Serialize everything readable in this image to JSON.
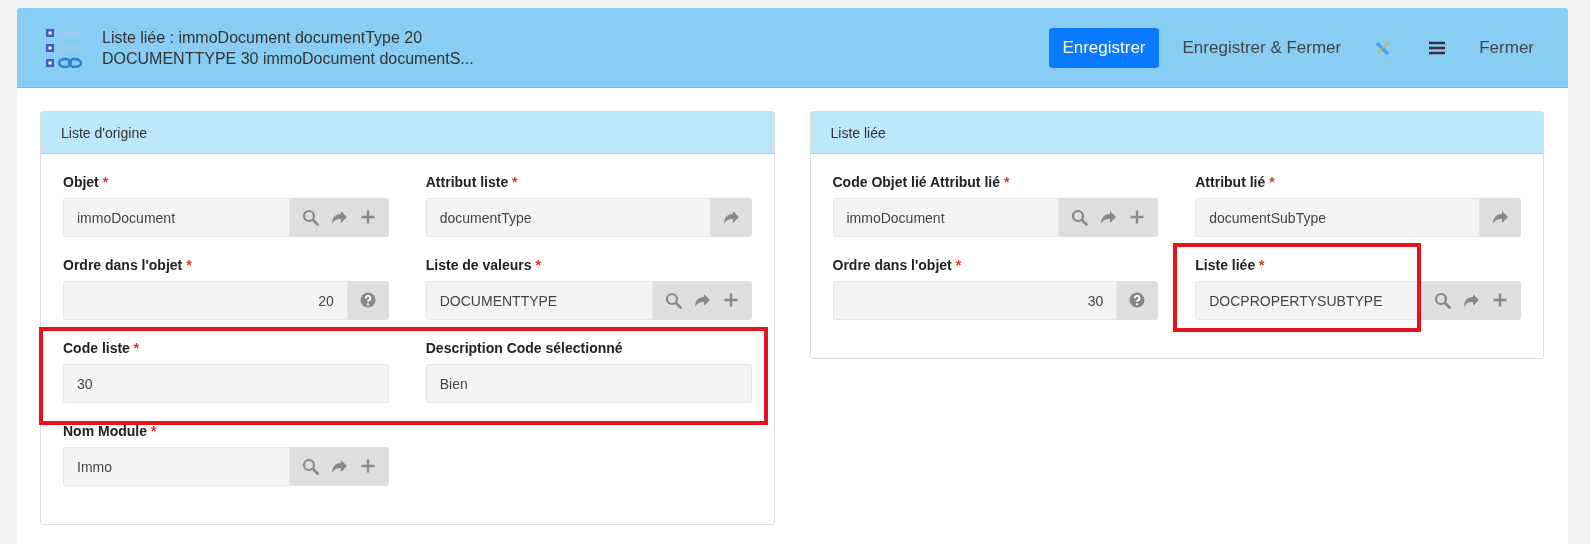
{
  "header": {
    "title_lines": [
      "Liste liée : immoDocument documentType 20",
      "DOCUMENTTYPE 30 immoDocument documentS..."
    ],
    "actions": [
      {
        "kind": "primary",
        "label": "Enregistrer"
      },
      {
        "kind": "text",
        "label": "Enregistrer & Fermer"
      },
      {
        "kind": "tools"
      },
      {
        "kind": "menu"
      },
      {
        "kind": "text",
        "label": "Fermer"
      }
    ]
  },
  "panels": [
    {
      "title": "Liste d'origine",
      "rows": [
        {
          "highlighted": false,
          "fields": [
            {
              "label": "Objet",
              "required_mark": "*",
              "kind": "text",
              "value": "immoDocument",
              "highlighted": false,
              "buttons": [
                {
                  "kind": "search"
                },
                {
                  "kind": "forward"
                },
                {
                  "kind": "add"
                }
              ]
            },
            {
              "label": "Attribut liste",
              "required_mark": "*",
              "kind": "text",
              "value": "documentType",
              "highlighted": false,
              "buttons": [
                {
                  "kind": "forward"
                }
              ]
            }
          ]
        },
        {
          "highlighted": false,
          "fields": [
            {
              "label": "Ordre dans l'objet",
              "required_mark": "*",
              "kind": "number",
              "value": "20",
              "highlighted": false,
              "buttons": [
                {
                  "kind": "help"
                }
              ]
            },
            {
              "label": "Liste de valeurs",
              "required_mark": "*",
              "kind": "text",
              "value": "DOCUMENTTYPE",
              "highlighted": false,
              "buttons": [
                {
                  "kind": "search"
                },
                {
                  "kind": "forward"
                },
                {
                  "kind": "add"
                }
              ]
            }
          ]
        },
        {
          "highlighted": true,
          "fields": [
            {
              "label": "Code liste",
              "required_mark": "*",
              "kind": "text",
              "value": "30",
              "highlighted": false
            },
            {
              "label": "Description Code sélectionné",
              "kind": "text",
              "value": "Bien",
              "highlighted": false
            }
          ]
        },
        {
          "highlighted": false,
          "fields": [
            {
              "label": "Nom Module",
              "required_mark": "*",
              "kind": "text",
              "value": "Immo",
              "highlighted": false,
              "buttons": [
                {
                  "kind": "search"
                },
                {
                  "kind": "forward"
                },
                {
                  "kind": "add"
                }
              ]
            }
          ]
        }
      ]
    },
    {
      "title": "Liste liée",
      "rows": [
        {
          "highlighted": false,
          "fields": [
            {
              "label": "Code Objet lié Attribut lié",
              "required_mark": "*",
              "kind": "text",
              "value": "immoDocument",
              "highlighted": false,
              "buttons": [
                {
                  "kind": "search"
                },
                {
                  "kind": "forward"
                },
                {
                  "kind": "add"
                }
              ]
            },
            {
              "label": "Attribut lié",
              "required_mark": "*",
              "kind": "text",
              "value": "documentSubType",
              "highlighted": false,
              "buttons": [
                {
                  "kind": "forward"
                }
              ]
            }
          ]
        },
        {
          "highlighted": false,
          "fields": [
            {
              "label": "Ordre dans l'objet",
              "required_mark": "*",
              "kind": "number",
              "value": "30",
              "highlighted": false,
              "buttons": [
                {
                  "kind": "help"
                }
              ]
            },
            {
              "label": "Liste liée",
              "required_mark": "*",
              "kind": "text",
              "value": "DOCPROPERTYSUBTYPE",
              "highlighted": true,
              "buttons": [
                {
                  "kind": "search"
                },
                {
                  "kind": "forward"
                },
                {
                  "kind": "add"
                }
              ]
            }
          ]
        }
      ]
    }
  ]
}
